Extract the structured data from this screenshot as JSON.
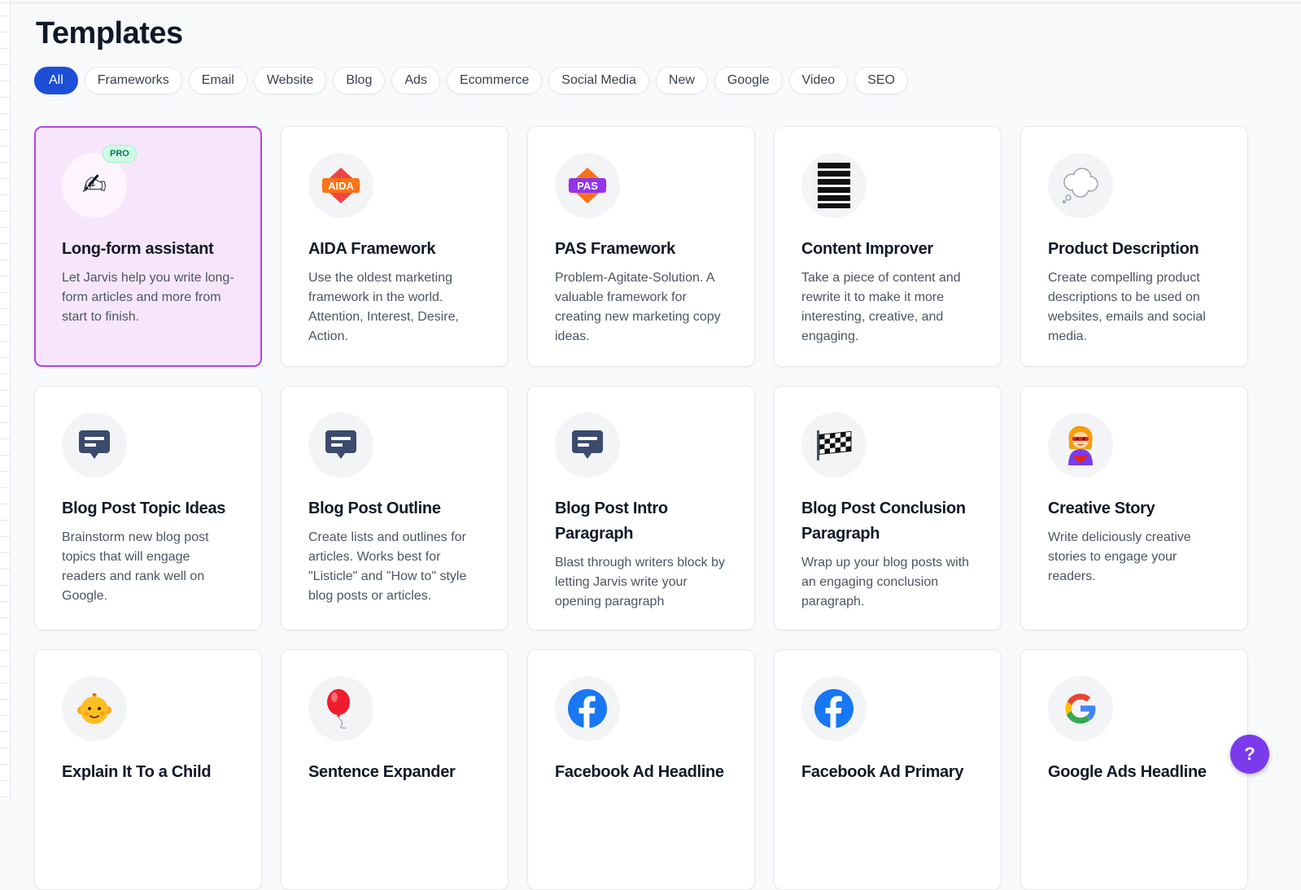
{
  "page": {
    "title": "Templates"
  },
  "filters": [
    "All",
    "Frameworks",
    "Email",
    "Website",
    "Blog",
    "Ads",
    "Ecommerce",
    "Social Media",
    "New",
    "Google",
    "Video",
    "SEO"
  ],
  "active_filter": "All",
  "colors": {
    "accent": "#1d4ed8",
    "selected_bg": "#f7e6fb",
    "selected_border": "#b046e4",
    "help_button": "#7c3aed",
    "pro_badge": "#d1fae5"
  },
  "templates": [
    {
      "title": "Long-form assistant",
      "description": "Let Jarvis help you write long-form articles and more from start to finish.",
      "icon": "writing-hand-icon",
      "badge": "PRO",
      "selected": true
    },
    {
      "title": "AIDA Framework",
      "description": "Use the oldest marketing framework in the world. Attention, Interest, Desire, Action.",
      "icon": "aida-icon",
      "icon_text": "AIDA"
    },
    {
      "title": "PAS Framework",
      "description": "Problem-Agitate-Solution. A valuable framework for creating new marketing copy ideas.",
      "icon": "pas-icon",
      "icon_text": "PAS"
    },
    {
      "title": "Content Improver",
      "description": "Take a piece of content and rewrite it to make it more interesting, creative, and engaging.",
      "icon": "text-lines-icon"
    },
    {
      "title": "Product Description",
      "description": "Create compelling product descriptions to be used on websites, emails and social media.",
      "icon": "thought-bubble-icon"
    },
    {
      "title": "Blog Post Topic Ideas",
      "description": "Brainstorm new blog post topics that will engage readers and rank well on Google.",
      "icon": "message-icon"
    },
    {
      "title": "Blog Post Outline",
      "description": "Create lists and outlines for articles. Works best for \"Listicle\" and \"How to\" style blog posts or articles.",
      "icon": "message-icon"
    },
    {
      "title": "Blog Post Intro Paragraph",
      "description": "Blast through writers block by letting Jarvis write your opening paragraph",
      "icon": "message-icon"
    },
    {
      "title": "Blog Post Conclusion Paragraph",
      "description": "Wrap up your blog posts with an engaging conclusion paragraph.",
      "icon": "checkered-flag-icon"
    },
    {
      "title": "Creative Story",
      "description": "Write deliciously creative stories to engage your readers.",
      "icon": "superhero-icon"
    },
    {
      "title": "Explain It To a Child",
      "description": "",
      "icon": "baby-face-icon"
    },
    {
      "title": "Sentence Expander",
      "description": "",
      "icon": "balloon-icon"
    },
    {
      "title": "Facebook Ad Headline",
      "description": "",
      "icon": "facebook-icon"
    },
    {
      "title": "Facebook Ad Primary",
      "description": "",
      "icon": "facebook-icon"
    },
    {
      "title": "Google Ads Headline",
      "description": "",
      "icon": "google-icon"
    }
  ],
  "help": {
    "label": "?"
  }
}
